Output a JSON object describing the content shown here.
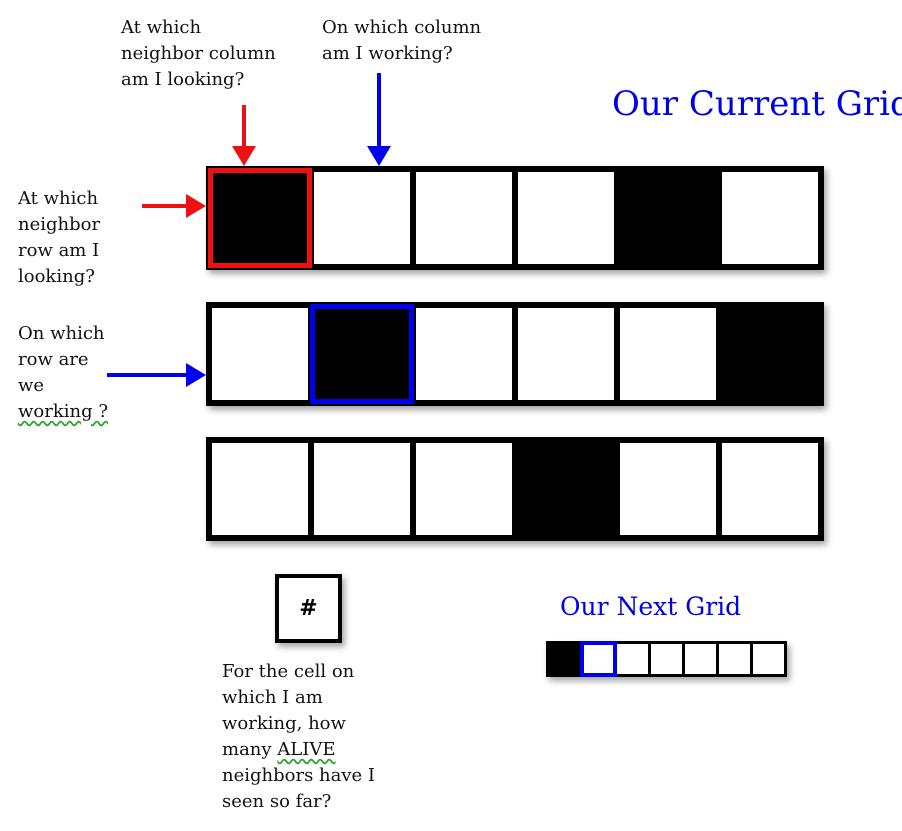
{
  "current_grid": {
    "title": "Our Current Grid",
    "rows": [
      [
        1,
        0,
        0,
        0,
        1,
        0
      ],
      [
        0,
        1,
        0,
        0,
        0,
        1
      ],
      [
        0,
        0,
        0,
        1,
        0,
        0
      ]
    ],
    "highlight_red": {
      "row": 0,
      "col": 0
    },
    "highlight_blue": {
      "row": 1,
      "col": 1
    }
  },
  "next_grid": {
    "title": "Our Next Grid",
    "cells": [
      1,
      0,
      0,
      0,
      0,
      0,
      0
    ],
    "highlight_blue": 1
  },
  "labels": {
    "neighbor_column": "At which\nneighbor column\nam I looking?",
    "working_column": "On which column\nam I working?",
    "neighbor_row": "At which\nneighbor\nrow am I\nlooking?",
    "working_row_1": "On which\nrow are\nwe\n",
    "working_row_2": "working ?",
    "counter_symbol": "#",
    "counter_question_1": "For the cell on\nwhich I am\nworking, how\nmany ",
    "counter_question_alive": "ALIVE",
    "counter_question_2": "\nneighbors have I\nseen so far?"
  },
  "colors": {
    "red": "#ee1111",
    "blue": "#0000ee",
    "cell_alive": "#000000",
    "cell_dead": "#ffffff"
  }
}
